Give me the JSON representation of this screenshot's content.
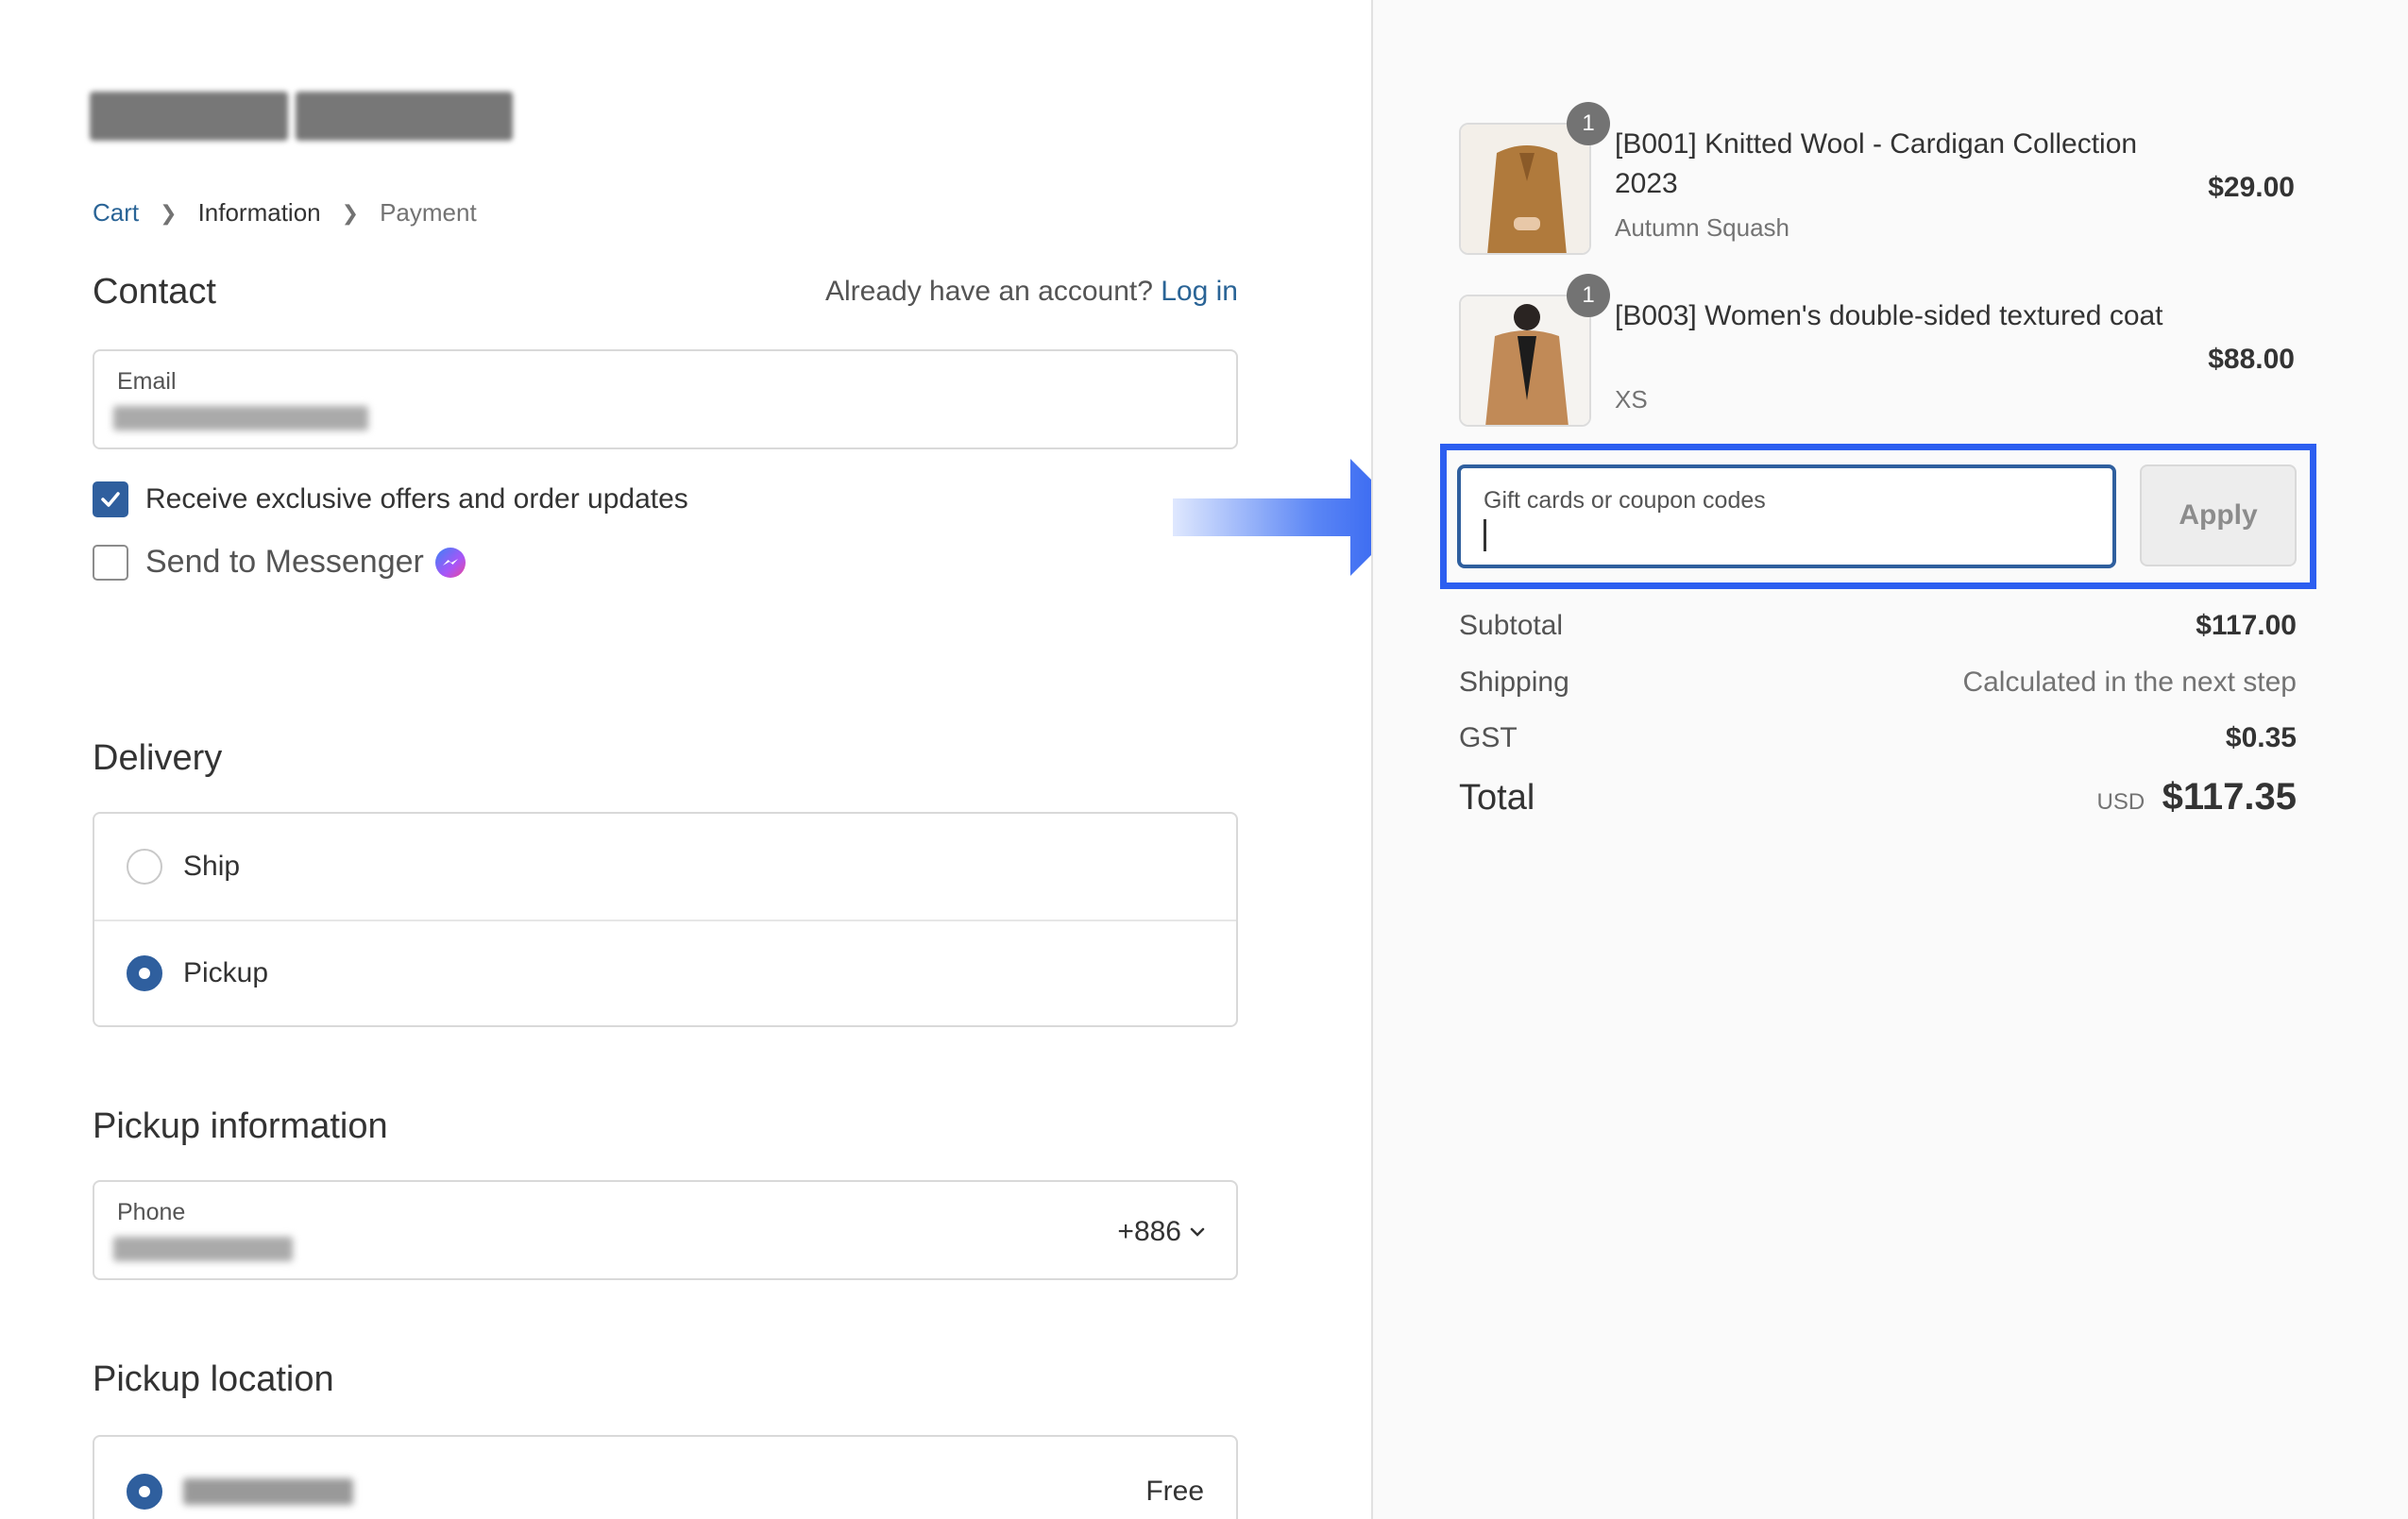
{
  "breadcrumb": {
    "cart": "Cart",
    "information": "Information",
    "payment": "Payment"
  },
  "contact": {
    "title": "Contact",
    "account_prompt": "Already have an account?",
    "login": "Log in",
    "email_label": "Email",
    "offers_label": "Receive exclusive offers and order updates",
    "offers_checked": true,
    "messenger_label": "Send to Messenger",
    "messenger_checked": false
  },
  "delivery": {
    "title": "Delivery",
    "options": [
      {
        "label": "Ship",
        "selected": false
      },
      {
        "label": "Pickup",
        "selected": true
      }
    ]
  },
  "pickup_info": {
    "title": "Pickup information",
    "phone_label": "Phone",
    "country_code": "+886"
  },
  "pickup_location": {
    "title": "Pickup location",
    "price": "Free"
  },
  "cart": {
    "items": [
      {
        "quantity": "1",
        "name": "[B001] Knitted Wool - Cardigan Collection 2023",
        "variant": "Autumn Squash",
        "price": "$29.00"
      },
      {
        "quantity": "1",
        "name": "[B003] Women's double-sided textured coat",
        "variant": "XS",
        "price": "$88.00"
      }
    ],
    "coupon_placeholder": "Gift cards or coupon codes",
    "apply_label": "Apply",
    "subtotal_label": "Subtotal",
    "subtotal": "$117.00",
    "shipping_label": "Shipping",
    "shipping": "Calculated in the next step",
    "tax_label": "GST",
    "tax": "$0.35",
    "total_label": "Total",
    "currency": "USD",
    "total": "$117.35"
  },
  "colors": {
    "accent": "#2f5f9e",
    "highlight": "#2c5ef0",
    "link": "#2a6496"
  }
}
